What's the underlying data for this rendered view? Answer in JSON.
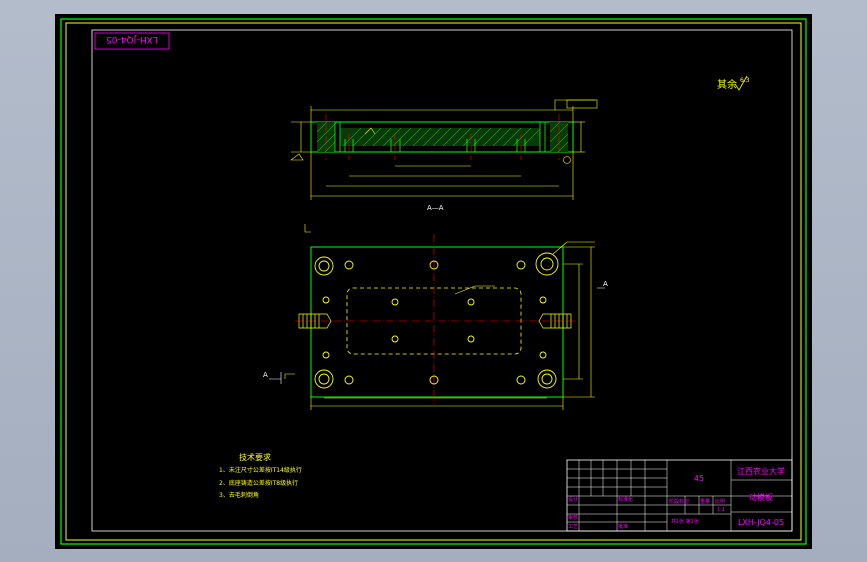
{
  "drawing": {
    "code_stamp": "LXH-JQ4-05",
    "roughness_note": "其余",
    "roughness_value": "6.3",
    "section_label": "A—A",
    "view_label_a1": "A",
    "view_label_a2": "A"
  },
  "technical_requirements": {
    "title": "技术要求",
    "items": [
      "1、未注尺寸公差按IT14级执行",
      "2、底座铸造公差按IT8级执行",
      "3、去毛刺倒角"
    ]
  },
  "title_block": {
    "material": "45",
    "school": "江西农业大学",
    "part_name": "动模板",
    "drawing_no": "LXH-JQ4-05",
    "scale_header": "比例",
    "scale_value": "1:1",
    "stage_label": "阶段标记",
    "weight_label": "重量",
    "sheet_label": "共1张 第1张",
    "designer": "设计",
    "checker": "审核",
    "process": "工艺",
    "standard": "标准化",
    "approve": "批准"
  },
  "colors": {
    "outer_frame": "#00ff00",
    "inner_frame": "#ffff00",
    "title_block_frame": "#ffffff",
    "part_outline": "#00ff00",
    "dimension": "#ffff00",
    "center_line": "#ff0000",
    "hatch": "#00ff00",
    "magenta_text": "#ff00ff"
  }
}
